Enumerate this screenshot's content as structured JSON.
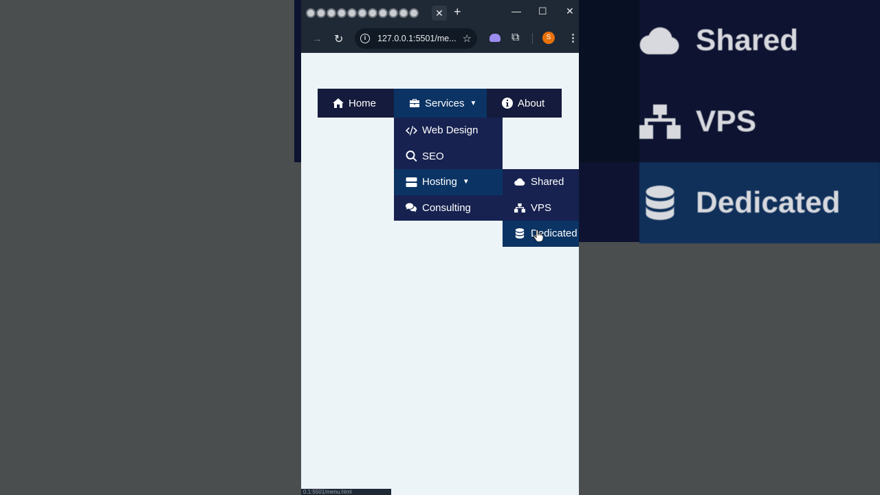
{
  "browser": {
    "url": "127.0.0.1:5501/me...",
    "profile_initial": "S",
    "status_text": "0.1:5501/menu.html"
  },
  "menu": {
    "home": "Home",
    "services": "Services",
    "about": "About",
    "caret": "▼"
  },
  "dropdown": {
    "items": [
      "Web Design",
      "SEO",
      "Hosting",
      "Consulting"
    ],
    "active_index": 2
  },
  "submenu": {
    "items": [
      "Shared",
      "VPS",
      "Dedicated"
    ],
    "active_index": 2
  },
  "zoom": {
    "items": [
      "Shared",
      "VPS",
      "Dedicated"
    ]
  },
  "colors": {
    "menu_bg": "#141b3c",
    "dropdown_bg": "#172250",
    "active_bg": "#0b3464",
    "page_bg": "#edf4f7"
  }
}
